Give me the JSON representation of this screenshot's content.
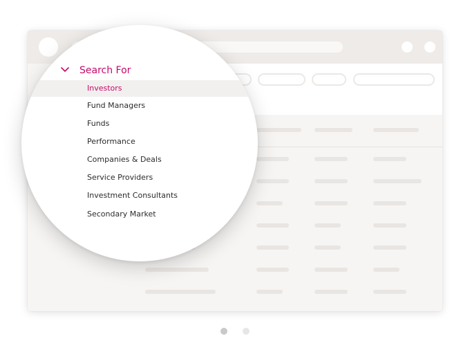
{
  "menu": {
    "heading": "Search For",
    "items": [
      {
        "label": "Investors",
        "active": true
      },
      {
        "label": "Fund Managers",
        "active": false
      },
      {
        "label": "Funds",
        "active": false
      },
      {
        "label": "Performance",
        "active": false
      },
      {
        "label": "Companies & Deals",
        "active": false
      },
      {
        "label": "Service Providers",
        "active": false
      },
      {
        "label": "Investment Consultants",
        "active": false
      },
      {
        "label": "Secondary Market",
        "active": false
      }
    ]
  },
  "carousel": {
    "page_count": 2,
    "active_page": 1
  },
  "colors": {
    "accent": "#c6076b",
    "dot_active": "#c9c9c9",
    "dot_inactive": "#e6e6e6"
  }
}
